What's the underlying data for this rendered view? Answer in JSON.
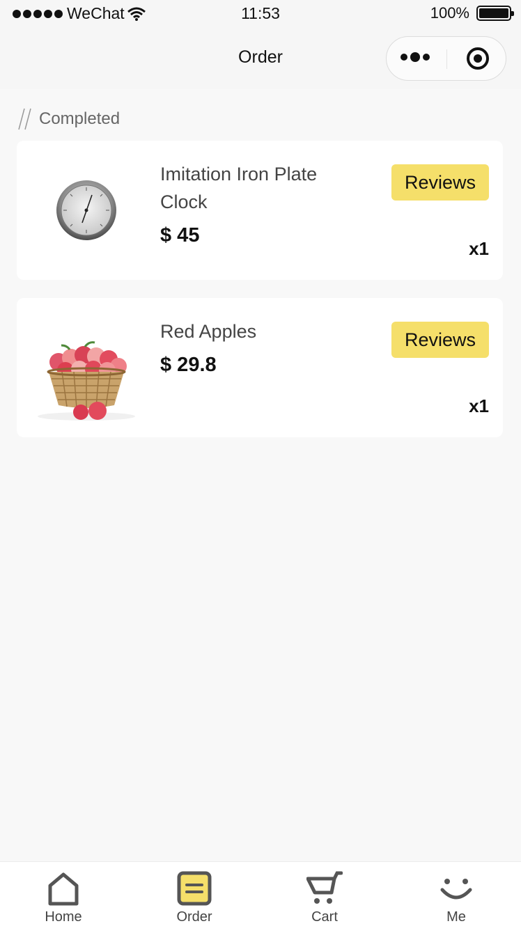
{
  "status_bar": {
    "carrier": "WeChat",
    "time": "11:53",
    "battery": "100%"
  },
  "nav": {
    "title": "Order"
  },
  "section": {
    "title": "Completed"
  },
  "orders": [
    {
      "name": "Imitation Iron Plate Clock",
      "price": "$ 45",
      "review_label": "Reviews",
      "quantity": "x1",
      "image_icon": "clock-product-image"
    },
    {
      "name": "Red Apples",
      "price": "$ 29.8",
      "review_label": "Reviews",
      "quantity": "x1",
      "image_icon": "apples-product-image"
    }
  ],
  "tabs": [
    {
      "label": "Home",
      "icon": "home-icon"
    },
    {
      "label": "Order",
      "icon": "order-icon",
      "active": true
    },
    {
      "label": "Cart",
      "icon": "cart-icon"
    },
    {
      "label": "Me",
      "icon": "smile-icon"
    }
  ],
  "colors": {
    "accent": "#f5df6a",
    "background": "#f8f8f8",
    "card": "#ffffff"
  }
}
